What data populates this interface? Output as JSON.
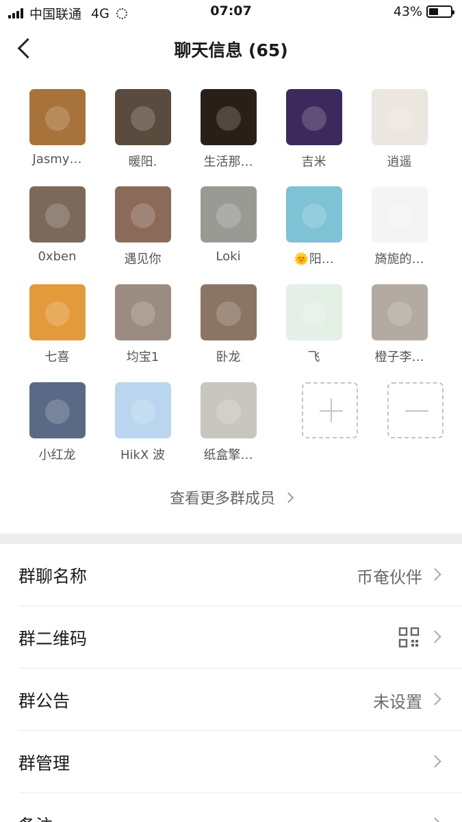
{
  "status": {
    "carrier": "中国联通",
    "network": "4G",
    "time": "07:07",
    "battery": "43%",
    "battery_level": 0.43
  },
  "nav": {
    "title": "聊天信息 (65)"
  },
  "members": [
    {
      "name": "Jasmy…",
      "color": "#a8733a"
    },
    {
      "name": "暖阳.",
      "color": "#5b4b3e"
    },
    {
      "name": "生活那…",
      "color": "#2a1f18"
    },
    {
      "name": "吉米",
      "color": "#3d2a5c"
    },
    {
      "name": "逍遥",
      "color": "#ece6e0"
    },
    {
      "name": "0xben",
      "color": "#7b6a5c"
    },
    {
      "name": "遇见你",
      "color": "#8b6a5a"
    },
    {
      "name": "Loki",
      "color": "#9a9a95"
    },
    {
      "name": "🌞阳…",
      "color": "#7ec2d6"
    },
    {
      "name": "旖旎的…",
      "color": "#f4f4f4"
    },
    {
      "name": "七喜",
      "color": "#e39a3b"
    },
    {
      "name": "均宝1",
      "color": "#9c8b80"
    },
    {
      "name": "卧龙",
      "color": "#8a7565"
    },
    {
      "name": "飞",
      "color": "#e4efe6"
    },
    {
      "name": "橙子李…",
      "color": "#b3aaa2"
    },
    {
      "name": "小红龙",
      "color": "#5a6a86"
    },
    {
      "name": "HikX 波",
      "color": "#b9d6ee"
    },
    {
      "name": "纸盒擎…",
      "color": "#c9c6c0"
    }
  ],
  "more_members": "查看更多群成员",
  "settings": [
    {
      "label": "群聊名称",
      "value": "币奄伙伴"
    },
    {
      "label": "群二维码",
      "value": ""
    },
    {
      "label": "群公告",
      "value": "未设置"
    },
    {
      "label": "群管理",
      "value": ""
    },
    {
      "label": "备注",
      "value": ""
    }
  ]
}
